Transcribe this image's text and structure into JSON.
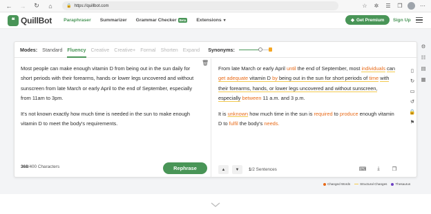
{
  "browser": {
    "url": "https://quillbot.com"
  },
  "header": {
    "logo_text": "QuillBot",
    "nav": [
      "Paraphraser",
      "Summarizer",
      "Grammar Checker"
    ],
    "beta_badge": "Beta",
    "extensions": "Extensions",
    "premium_button": "Get Premium",
    "signup": "Sign Up"
  },
  "editor": {
    "modes_label": "Modes:",
    "modes": [
      "Standard",
      "Fluency",
      "Creative",
      "Creative+",
      "Formal",
      "Shorten",
      "Expand"
    ],
    "active_mode": "Fluency",
    "synonyms_label": "Synonyms:",
    "synonyms_level": 0.78,
    "input_paragraphs": [
      "Most people can make enough vitamin D from being out in the sun daily for short periods with their forearms, hands or lower legs uncovered and without sunscreen from late March or early April to the end of September, especially from 11am to 3pm.",
      "It's not known exactly how much time is needed in the sun to make enough vitamin D to meet the body's requirements."
    ],
    "char_count": "368",
    "char_limit": "/400 Characters",
    "rephrase_button": "Rephrase",
    "output": {
      "p1": {
        "a": "From late March or early April ",
        "b": "until",
        "c": " the end of September, most ",
        "d": "individuals",
        "e": "can",
        "f": "get adequate",
        "g": " vitamin D ",
        "h": "by",
        "i": " being out in the sun for short periods of ",
        "j": "time",
        "k": "with their forearms, hands, or lower legs uncovered and without sunscreen,",
        "l": "especially",
        "m": "between",
        "n": " 11 a.m. and 3 p.m."
      },
      "p2": {
        "a": "It is ",
        "b": "unknown",
        "c": " how much time in the sun is ",
        "d": "required",
        "e": " to ",
        "f": "produce",
        "g": " enough vitamin D to ",
        "h": "fulfil",
        "i": " the body's ",
        "j": "needs."
      }
    },
    "sentence_index": "1",
    "sentence_total": "/2 Sentences"
  },
  "legend": [
    "Changed Words",
    "Structural Changes",
    "Thesaurus"
  ],
  "colors": {
    "brand": "#499557",
    "changed": "#e86a18",
    "structural": "#f2c94c",
    "thesaurus": "#6c3fc2"
  }
}
